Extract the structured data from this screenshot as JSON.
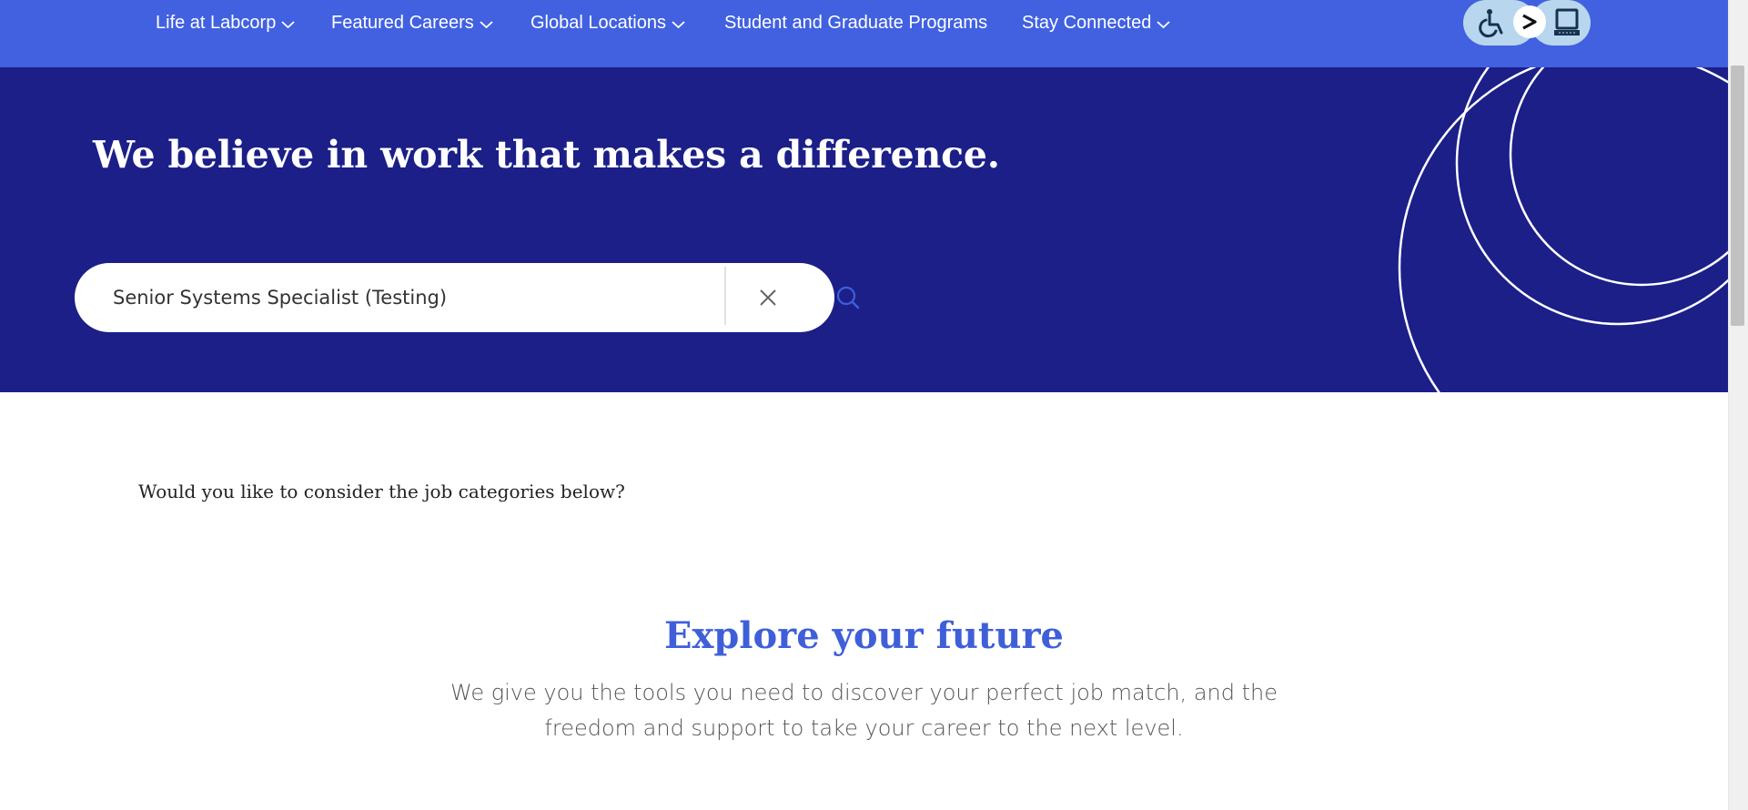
{
  "nav": {
    "items": [
      {
        "label": "Life at Labcorp",
        "has_dropdown": true
      },
      {
        "label": "Featured Careers",
        "has_dropdown": true
      },
      {
        "label": "Global Locations",
        "has_dropdown": true
      },
      {
        "label": "Student and Graduate Programs",
        "has_dropdown": false
      },
      {
        "label": "Stay Connected",
        "has_dropdown": true
      }
    ],
    "accessibility_icons": [
      "wheelchair-icon",
      "chevron-right-icon",
      "computer-icon"
    ]
  },
  "hero": {
    "title": "We believe in work that makes a difference.",
    "search": {
      "value": "Senior Systems Specialist (Testing)",
      "clear_icon": "close-icon",
      "submit_icon": "search-icon"
    }
  },
  "content": {
    "prompt": "Would you like to consider the job categories below?",
    "explore_title": "Explore your future",
    "explore_desc_line1": "We give you the tools you need to discover your perfect job match, and the",
    "explore_desc_line2": "freedom and support to take your career to the next level."
  },
  "colors": {
    "nav_bg": "#4161e0",
    "hero_bg": "#1b1f87",
    "accent": "#3f5fd9",
    "a11y_bg": "#b9d6ef"
  }
}
